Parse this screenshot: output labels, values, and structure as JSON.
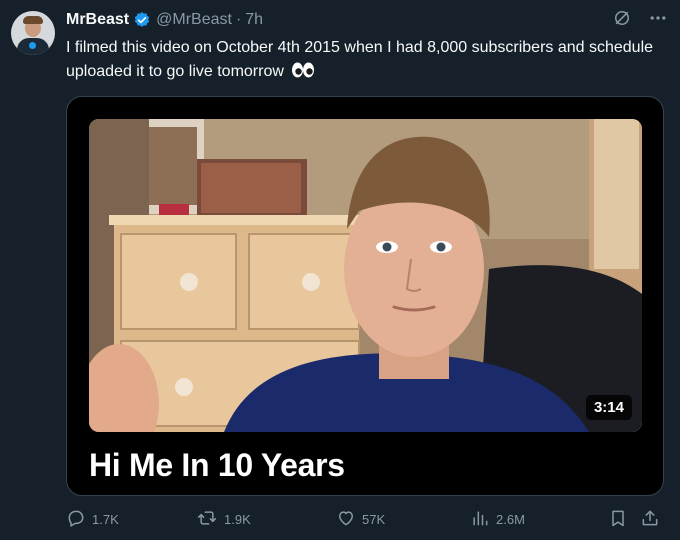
{
  "tweet": {
    "display_name": "MrBeast",
    "handle": "@MrBeast",
    "separator": "·",
    "time": "7h",
    "text": "I filmed this video on October 4th 2015 when I had 8,000 subscribers and schedule uploaded it to go live tomorrow"
  },
  "video": {
    "title": "Hi Me In 10 Years",
    "duration": "3:14"
  },
  "actions": {
    "replies": "1.7K",
    "reposts": "1.9K",
    "likes": "57K",
    "views": "2.6M"
  },
  "icons": [
    "verified-badge-icon",
    "grok-icon",
    "more-icon",
    "eyes-emoji",
    "reply-icon",
    "repost-icon",
    "like-icon",
    "views-icon",
    "bookmark-icon",
    "share-icon"
  ],
  "colors": {
    "background": "#15202b",
    "muted": "#8b98a5",
    "accent": "#1d9bf0",
    "text": "#f7f9f9"
  }
}
